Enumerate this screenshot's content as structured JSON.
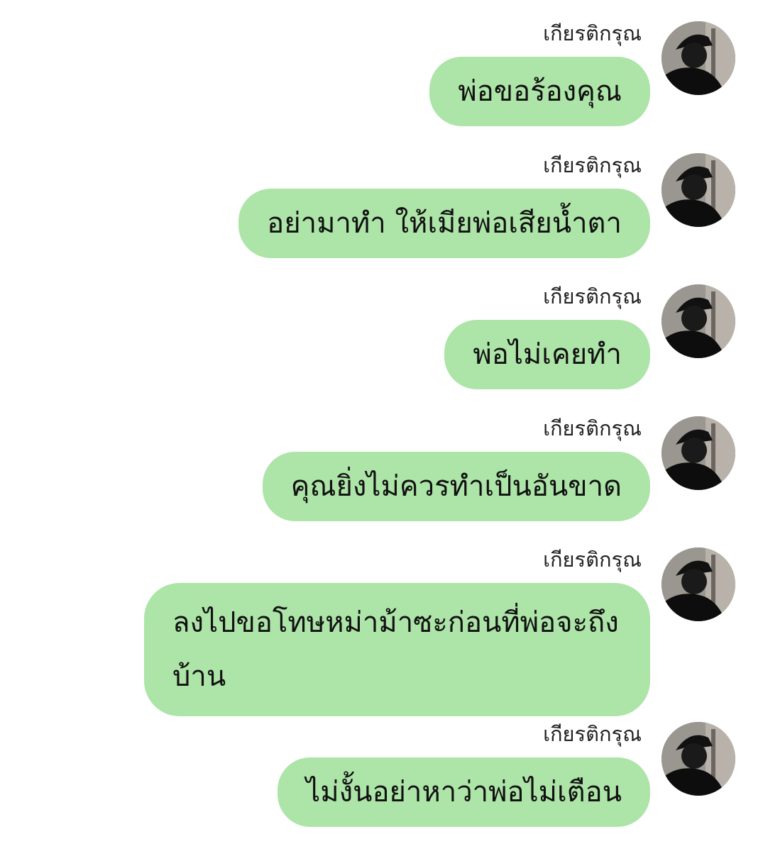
{
  "chat": {
    "messages": [
      {
        "sender": "เกียรติกรุณ",
        "text": "พ่อขอร้องคุณ"
      },
      {
        "sender": "เกียรติกรุณ",
        "text": "อย่ามาทำ ให้เมียพ่อเสียน้ำตา"
      },
      {
        "sender": "เกียรติกรุณ",
        "text": "พ่อไม่เคยทำ"
      },
      {
        "sender": "เกียรติกรุณ",
        "text": "คุณยิ่งไม่ควรทำเป็นอันขาด"
      },
      {
        "sender": "เกียรติกรุณ",
        "text": "ลงไปขอโทษหม่าม้าซะก่อนที่พ่อจะถึงบ้าน"
      },
      {
        "sender": "เกียรติกรุณ",
        "text": "ไม่งั้นอย่าหาว่าพ่อไม่เตือน"
      }
    ]
  },
  "colors": {
    "bubble": "#ade4a8",
    "background": "#ffffff"
  },
  "icons": {
    "avatar": "avatar-photo-person-in-cap"
  }
}
